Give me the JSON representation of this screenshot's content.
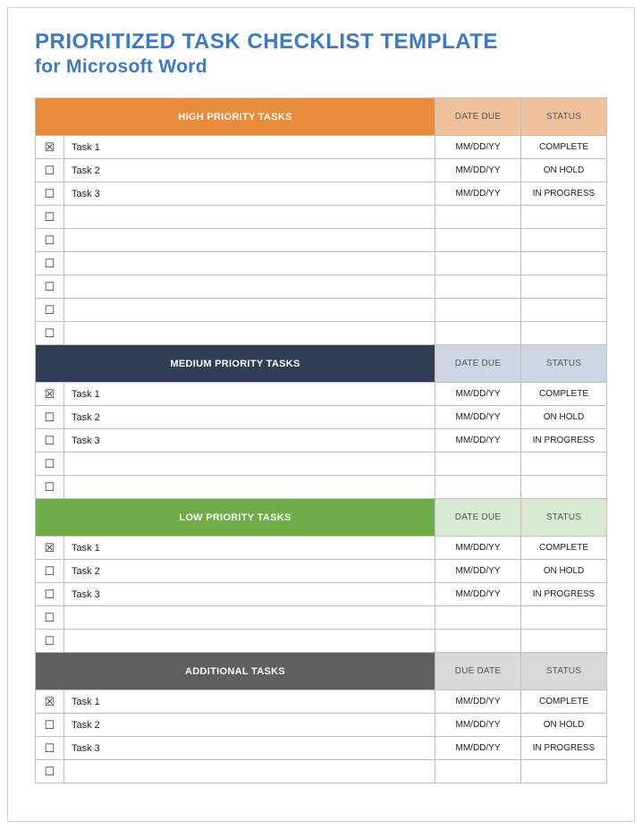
{
  "title": {
    "line1": "PRIORITIZED TASK CHECKLIST TEMPLATE",
    "line2": "for Microsoft Word"
  },
  "glyphs": {
    "checked": "☒",
    "unchecked": "☐"
  },
  "sections": [
    {
      "name": "HIGH PRIORITY TASKS",
      "mainColor": "#e88b3a",
      "subColor": "#f1c19b",
      "dateHeader": "DATE DUE",
      "statusHeader": "STATUS",
      "rows": [
        {
          "checked": true,
          "task": "Task 1",
          "date": "MM/DD/YY",
          "status": "COMPLETE"
        },
        {
          "checked": false,
          "task": "Task 2",
          "date": "MM/DD/YY",
          "status": "ON HOLD"
        },
        {
          "checked": false,
          "task": "Task 3",
          "date": "MM/DD/YY",
          "status": "IN PROGRESS"
        },
        {
          "checked": false,
          "task": "",
          "date": "",
          "status": ""
        },
        {
          "checked": false,
          "task": "",
          "date": "",
          "status": ""
        },
        {
          "checked": false,
          "task": "",
          "date": "",
          "status": ""
        },
        {
          "checked": false,
          "task": "",
          "date": "",
          "status": ""
        },
        {
          "checked": false,
          "task": "",
          "date": "",
          "status": ""
        },
        {
          "checked": false,
          "task": "",
          "date": "",
          "status": ""
        }
      ]
    },
    {
      "name": "MEDIUM PRIORITY TASKS",
      "mainColor": "#2f3e54",
      "subColor": "#cdd6e2",
      "dateHeader": "DATE DUE",
      "statusHeader": "STATUS",
      "rows": [
        {
          "checked": true,
          "task": "Task 1",
          "date": "MM/DD/YY",
          "status": "COMPLETE"
        },
        {
          "checked": false,
          "task": "Task 2",
          "date": "MM/DD/YY",
          "status": "ON HOLD"
        },
        {
          "checked": false,
          "task": "Task 3",
          "date": "MM/DD/YY",
          "status": "IN PROGRESS"
        },
        {
          "checked": false,
          "task": "",
          "date": "",
          "status": ""
        },
        {
          "checked": false,
          "task": "",
          "date": "",
          "status": ""
        }
      ]
    },
    {
      "name": "LOW PRIORITY TASKS",
      "mainColor": "#6eab49",
      "subColor": "#d9ead2",
      "dateHeader": "DATE DUE",
      "statusHeader": "STATUS",
      "rows": [
        {
          "checked": true,
          "task": "Task 1",
          "date": "MM/DD/YY",
          "status": "COMPLETE"
        },
        {
          "checked": false,
          "task": "Task 2",
          "date": "MM/DD/YY",
          "status": "ON HOLD"
        },
        {
          "checked": false,
          "task": "Task 3",
          "date": "MM/DD/YY",
          "status": "IN PROGRESS"
        },
        {
          "checked": false,
          "task": "",
          "date": "",
          "status": ""
        },
        {
          "checked": false,
          "task": "",
          "date": "",
          "status": ""
        }
      ]
    },
    {
      "name": "ADDITIONAL TASKS",
      "mainColor": "#5f5f5f",
      "subColor": "#d9d9d9",
      "dateHeader": "DUE DATE",
      "statusHeader": "STATUS",
      "rows": [
        {
          "checked": true,
          "task": "Task 1",
          "date": "MM/DD/YY",
          "status": "COMPLETE"
        },
        {
          "checked": false,
          "task": "Task 2",
          "date": "MM/DD/YY",
          "status": "ON HOLD"
        },
        {
          "checked": false,
          "task": "Task 3",
          "date": "MM/DD/YY",
          "status": "IN PROGRESS"
        },
        {
          "checked": false,
          "task": "",
          "date": "",
          "status": ""
        }
      ]
    }
  ]
}
